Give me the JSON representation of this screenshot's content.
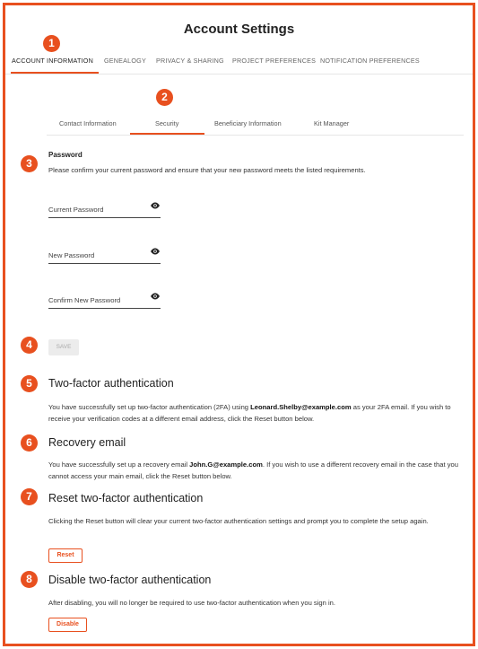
{
  "page": {
    "title": "Account Settings"
  },
  "main_tabs": [
    "ACCOUNT INFORMATION",
    "GENEALOGY",
    "PRIVACY & SHARING",
    "PROJECT PREFERENCES",
    "NOTIFICATION PREFERENCES"
  ],
  "sub_tabs": [
    "Contact Information",
    "Security",
    "Beneficiary Information",
    "Kit Manager"
  ],
  "badges": [
    "1",
    "2",
    "3",
    "4",
    "5",
    "6",
    "7",
    "8"
  ],
  "password": {
    "heading": "Password",
    "description": "Please confirm your current password and ensure that your new password meets the listed requirements.",
    "current_label": "Current Password",
    "new_label": "New Password",
    "confirm_label": "Confirm New Password",
    "save_label": "SAVE"
  },
  "two_factor": {
    "heading": "Two-factor authentication",
    "text_before": "You have successfully set up two-factor authentication (2FA) using ",
    "email": "Leonard.Shelby@example.com",
    "text_after": " as your 2FA email. If you wish to receive your verification codes at a different email address, click the Reset button below."
  },
  "recovery": {
    "heading": "Recovery email",
    "text_before": "You have successfully set up a recovery email ",
    "email": "John.G@example.com",
    "text_after": ". If you wish to use a different recovery email in the case that you cannot access your main email, click the Reset button below."
  },
  "reset": {
    "heading": "Reset two-factor authentication",
    "text": "Clicking the Reset button will clear your current two-factor authentication settings and prompt you to complete the setup again.",
    "button": "Reset"
  },
  "disable": {
    "heading": "Disable two-factor authentication",
    "text": "After disabling, you will no longer be required to use two-factor authentication when you sign in.",
    "button": "Disable"
  },
  "colors": {
    "accent": "#e8501f"
  }
}
